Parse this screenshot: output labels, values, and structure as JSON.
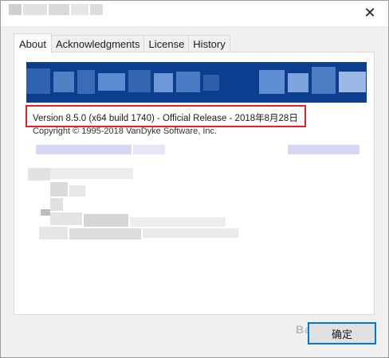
{
  "window": {
    "close_glyph": "✕"
  },
  "tabs": [
    {
      "label": "About",
      "active": true
    },
    {
      "label": "Acknowledgments",
      "active": false
    },
    {
      "label": "License",
      "active": false
    },
    {
      "label": "History",
      "active": false
    }
  ],
  "about": {
    "version_line": "Version 8.5.0 (x64 build 1740)   -   Official Release - 2018年8月28日",
    "copyright_line": "Copyright © 1995-2018 VanDyke Software, Inc."
  },
  "buttons": {
    "ok_label": "确定"
  },
  "watermark": {
    "text": "Bai 经验"
  },
  "colors": {
    "banner": "#0b3e8e",
    "highlight": "#e52121",
    "focus": "#0078d7"
  }
}
